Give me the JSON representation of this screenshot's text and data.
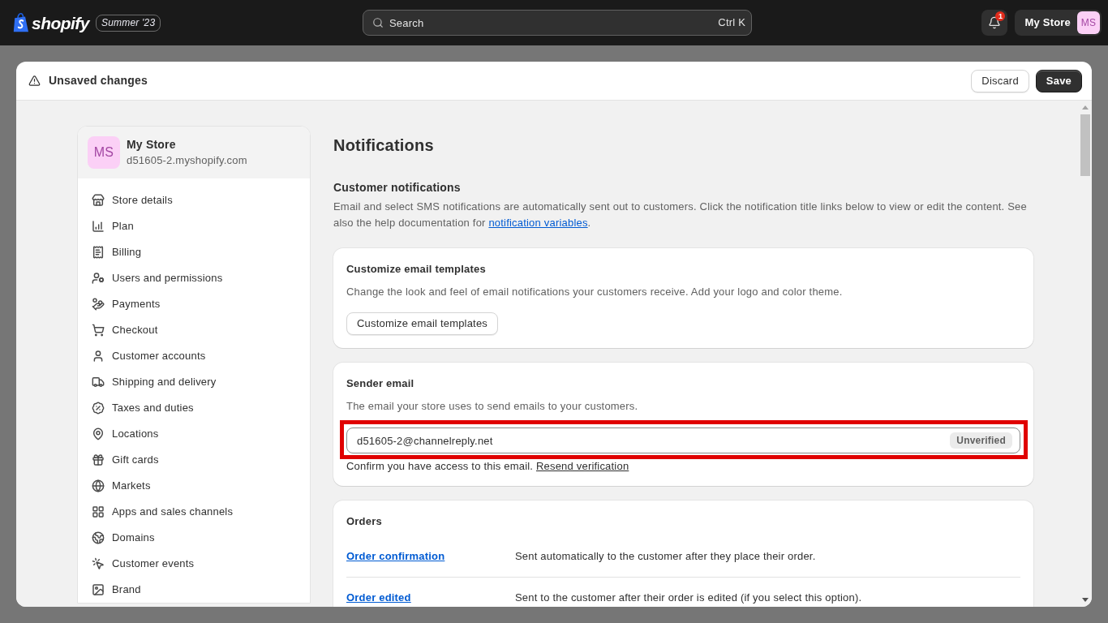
{
  "top_bar": {
    "logo": "shopify",
    "edition": "Summer '23",
    "search": {
      "placeholder": "Search",
      "shortcut": "Ctrl K"
    },
    "notification_count": "1",
    "account": {
      "name": "My Store",
      "initials": "MS"
    }
  },
  "save_bar": {
    "message": "Unsaved changes",
    "buttons": [
      {
        "label": "Discard",
        "kind": "secondary"
      },
      {
        "label": "Save",
        "kind": "primary"
      }
    ]
  },
  "settings_sidebar": {
    "store": {
      "initials": "MS",
      "name": "My Store",
      "domain": "d51605-2.myshopify.com"
    },
    "items": [
      "Store details",
      "Plan",
      "Billing",
      "Users and permissions",
      "Payments",
      "Checkout",
      "Customer accounts",
      "Shipping and delivery",
      "Taxes and duties",
      "Locations",
      "Gift cards",
      "Markets",
      "Apps and sales channels",
      "Domains",
      "Customer events",
      "Brand"
    ]
  },
  "page": {
    "title": "Notifications",
    "section": {
      "heading": "Customer notifications",
      "description": "Email and select SMS notifications are automatically sent out to customers. Click the notification title links below to view or edit the content. See also the help documentation for ",
      "link": "notification variables",
      "description_end": "."
    }
  },
  "templates_card": {
    "title": "Customize email templates",
    "description": "Change the look and feel of email notifications your customers receive. Add your logo and color theme.",
    "button": "Customize email templates"
  },
  "sender_card": {
    "title": "Sender email",
    "description": "The email your store uses to send emails to your customers.",
    "email": "d51605-2@channelreply.net",
    "status": "Unverified",
    "note": "Confirm you have access to this email. ",
    "note_link": "Resend verification",
    "highlighted": true
  },
  "orders_card": {
    "title": "Orders",
    "rows": [
      {
        "name": "Order confirmation",
        "description": "Sent automatically to the customer after they place their order."
      },
      {
        "name": "Order edited",
        "description": "Sent to the customer after their order is edited (if you select this option)."
      }
    ]
  }
}
